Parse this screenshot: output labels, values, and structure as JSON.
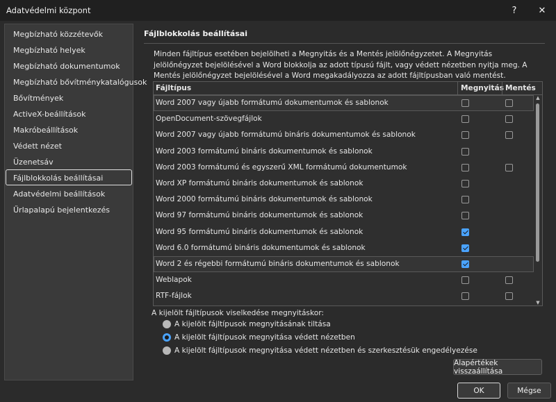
{
  "window": {
    "title": "Adatvédelmi központ",
    "help_glyph": "?",
    "close_glyph": "✕"
  },
  "sidebar": {
    "items": [
      {
        "label": "Megbízható közzétevők"
      },
      {
        "label": "Megbízható helyek"
      },
      {
        "label": "Megbízható dokumentumok"
      },
      {
        "label": "Megbízható bővítménykatalógusok"
      },
      {
        "label": "Bővítmények"
      },
      {
        "label": "ActiveX-beállítások"
      },
      {
        "label": "Makróbeállítások"
      },
      {
        "label": "Védett nézet"
      },
      {
        "label": "Üzenetsáv"
      },
      {
        "label": "Fájlblokkolás beállításai"
      },
      {
        "label": "Adatvédelmi beállítások"
      },
      {
        "label": "Űrlapalapú bejelentkezés"
      }
    ],
    "active_index": 9
  },
  "main": {
    "section_title": "Fájlblokkolás beállításai",
    "description": "Minden fájltípus esetében bejelölheti a Megnyitás és a Mentés jelölőnégyzetet. A Megnyitás jelölőnégyzet bejelölésével a Word blokkolja az adott típusú fájlt, vagy védett nézetben nyitja meg. A Mentés jelölőnégyzet bejelölésével a Word megakadályozza az adott fájltípusban való mentést."
  },
  "grid": {
    "headers": {
      "type": "Fájltípus",
      "open": "Megnyitás",
      "save": "Mentés"
    },
    "rows": [
      {
        "label": "Word 2007 vagy újabb formátumú dokumentumok és sablonok",
        "open": false,
        "save": false,
        "has_save": true,
        "highlight": true
      },
      {
        "label": "OpenDocument-szövegfájlok",
        "open": false,
        "save": false,
        "has_save": true,
        "highlight": false
      },
      {
        "label": "Word 2007 vagy újabb formátumú bináris dokumentumok és sablonok",
        "open": false,
        "save": false,
        "has_save": true,
        "highlight": false
      },
      {
        "label": "Word 2003 formátumú bináris dokumentumok és sablonok",
        "open": false,
        "save": false,
        "has_save": false,
        "highlight": false
      },
      {
        "label": "Word 2003 formátumú és egyszerű XML formátumú dokumentumok",
        "open": false,
        "save": false,
        "has_save": true,
        "highlight": false
      },
      {
        "label": "Word XP formátumú bináris dokumentumok és sablonok",
        "open": false,
        "save": false,
        "has_save": false,
        "highlight": false
      },
      {
        "label": "Word 2000 formátumú bináris dokumentumok és sablonok",
        "open": false,
        "save": false,
        "has_save": false,
        "highlight": false
      },
      {
        "label": "Word 97 formátumú bináris dokumentumok és sablonok",
        "open": false,
        "save": false,
        "has_save": false,
        "highlight": false
      },
      {
        "label": "Word 95 formátumú bináris dokumentumok és sablonok",
        "open": true,
        "save": false,
        "has_save": false,
        "highlight": false
      },
      {
        "label": "Word 6.0 formátumú bináris dokumentumok és sablonok",
        "open": true,
        "save": false,
        "has_save": false,
        "highlight": false
      },
      {
        "label": "Word 2 és régebbi formátumú bináris dokumentumok és sablonok",
        "open": true,
        "save": false,
        "has_save": false,
        "highlight": true
      },
      {
        "label": "Weblapok",
        "open": false,
        "save": false,
        "has_save": true,
        "highlight": false
      },
      {
        "label": "RTF-fájlok",
        "open": false,
        "save": false,
        "has_save": true,
        "highlight": false
      }
    ]
  },
  "behavior": {
    "label": "A kijelölt fájltípusok viselkedése megnyitáskor:",
    "options": [
      {
        "label": "A kijelölt fájltípusok megnyitásának tiltása",
        "selected": false
      },
      {
        "label": "A kijelölt fájltípusok megnyitása védett nézetben",
        "selected": true
      },
      {
        "label": "A kijelölt fájltípusok megnyitása védett nézetben és szerkesztésük engedélyezése",
        "selected": false
      }
    ]
  },
  "buttons": {
    "defaults": "Alapértékek visszaállítása",
    "ok": "OK",
    "cancel": "Mégse"
  },
  "colors": {
    "accent": "#4aa3ff",
    "background": "#2b2b2b"
  }
}
